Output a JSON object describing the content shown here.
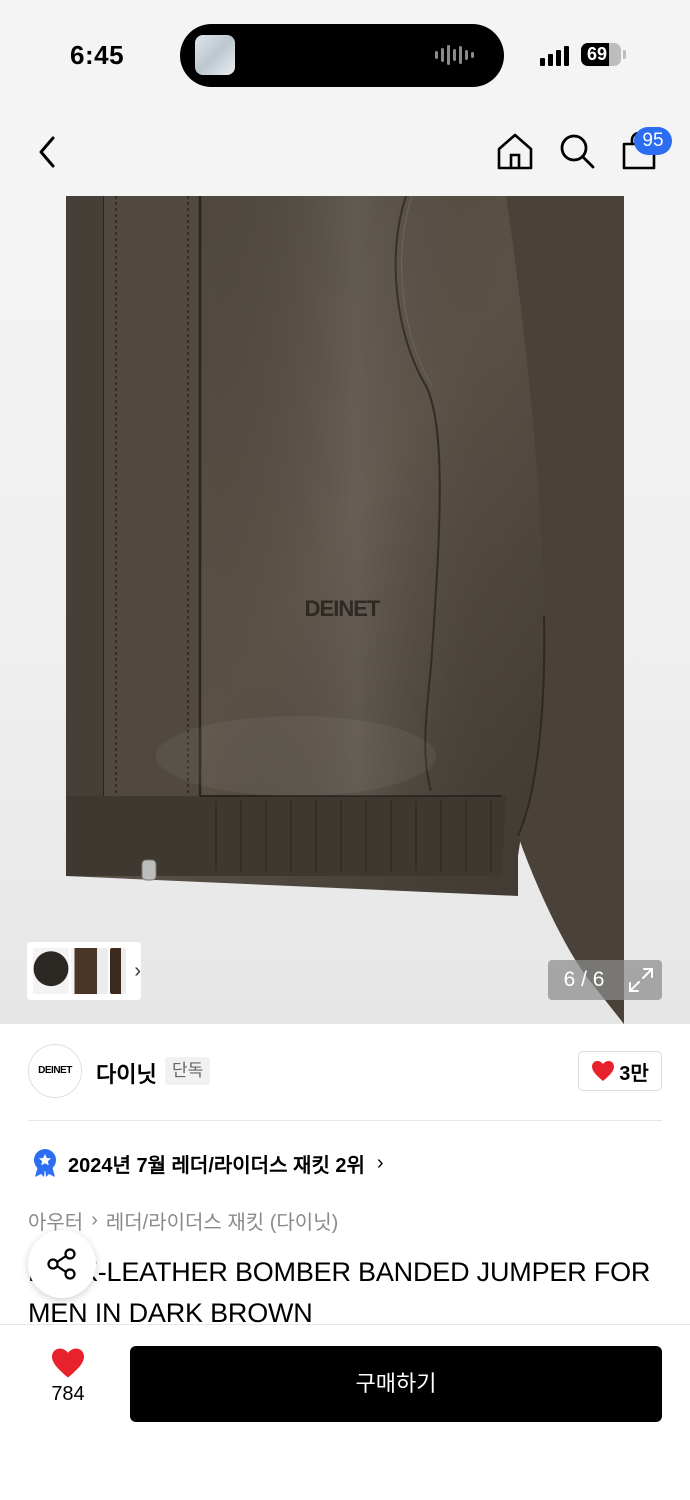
{
  "status_bar": {
    "time": "6:45",
    "battery": "69",
    "battery_level": 0.69
  },
  "nav": {
    "back_icon": "chevron-left-icon",
    "home_icon": "home-icon",
    "search_icon": "search-icon",
    "cart_icon": "shopping-bag-icon",
    "cart_badge": "95",
    "badge_color": "#2b6ef2"
  },
  "gallery": {
    "counter": "6 / 6",
    "fullscreen_icon": "expand-icon",
    "thumb_chevron": "›"
  },
  "brand": {
    "logo_text": "DEINET",
    "name": "다이닛",
    "tag": "단독",
    "like_count": "3만",
    "heart_color": "#e8222c"
  },
  "ranking": {
    "text": "2024년 7월 레더/라이더스 재킷 2위",
    "chevron": "›",
    "badge_color": "#2b6ef2"
  },
  "breadcrumb": {
    "category": "아우터",
    "separator": "›",
    "subcategory": "레더/라이더스 재킷 (다이닛)"
  },
  "product": {
    "title": "FAUX-LEATHER BOMBER BANDED JUMPER FOR MEN IN DARK BROWN",
    "image_logo": "DEINET"
  },
  "bottom_bar": {
    "wish_count": "784",
    "buy_label": "구매하기"
  }
}
